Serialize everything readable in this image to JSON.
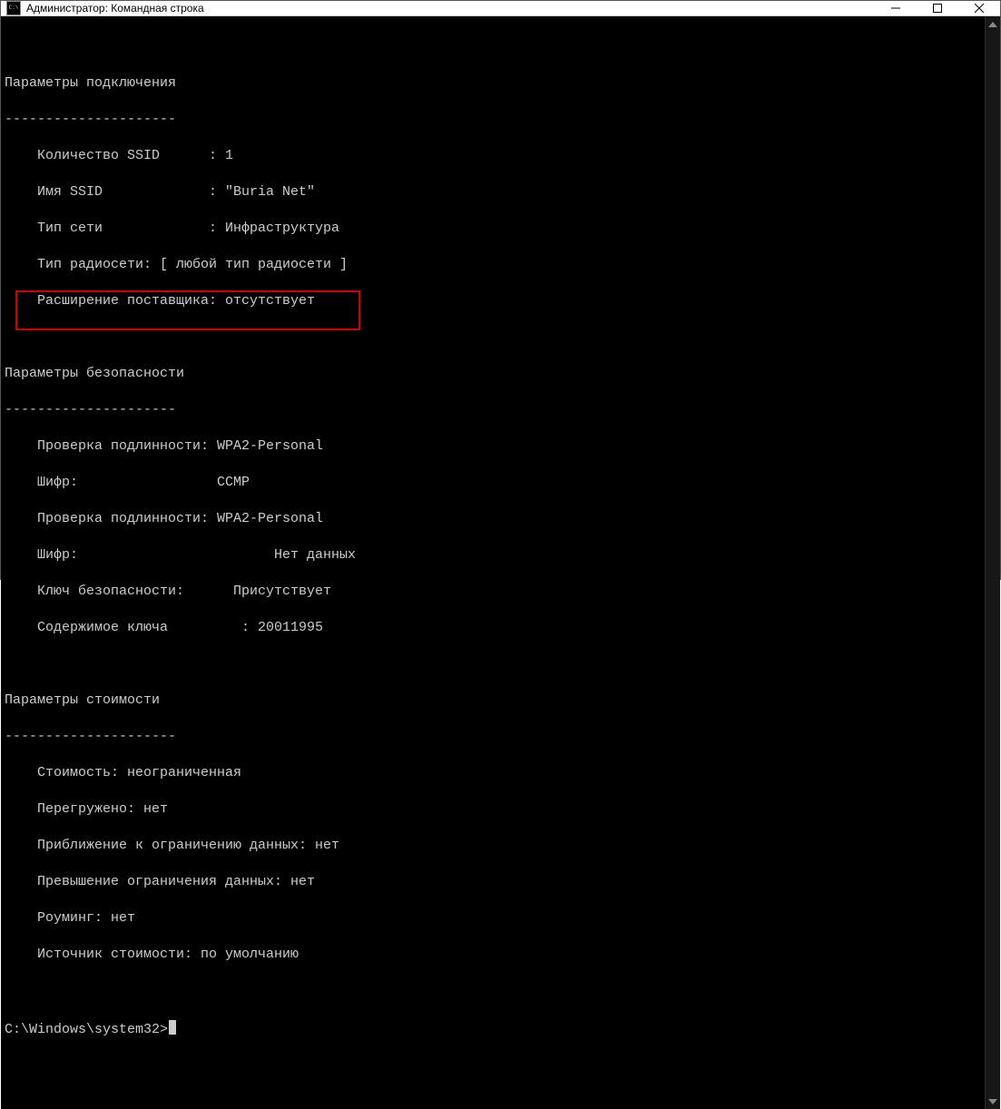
{
  "window": {
    "title": "Администратор: Командная строка"
  },
  "sep": "---------------------",
  "connection": {
    "heading": "Параметры подключения",
    "ssid_count": "    Количество SSID      : 1",
    "ssid_name": "    Имя SSID             : \"Buria Net\"",
    "net_type": "    Тип сети             : Инфраструктура",
    "radio_type": "    Тип радиосети: [ любой тип радиосети ]",
    "vendor_ext": "    Расширение поставщика: отсутствует"
  },
  "security": {
    "heading": "Параметры безопасности",
    "auth1": "    Проверка подлинности: WPA2-Personal",
    "cipher1": "    Шифр:                 CCMP",
    "auth2": "    Проверка подлинности: WPA2-Personal",
    "cipher2": "    Шифр:                        Нет данных",
    "key_present": "    Ключ безопасности:      Присутствует",
    "key_content": "    Содержимое ключа         : 20011995"
  },
  "cost": {
    "heading": "Параметры стоимости",
    "cost": "    Стоимость: неограниченная",
    "congested": "    Перегружено: нет",
    "approaching": "    Приближение к ограничению данных: нет",
    "over_limit": "    Превышение ограничения данных: нет",
    "roaming": "    Роуминг: нет",
    "source": "    Источник стоимости: по умолчанию"
  },
  "prompt": "C:\\Windows\\system32>"
}
